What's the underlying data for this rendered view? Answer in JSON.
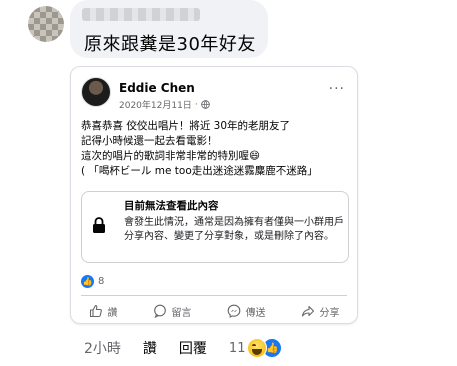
{
  "comment": {
    "text": "原來跟糞是30年好友",
    "time": "2小時",
    "like_label": "讚",
    "reply_label": "回覆",
    "reaction_count": "11"
  },
  "shared_post": {
    "author": "Eddie Chen",
    "date": "2020年12月11日",
    "more": "···",
    "lines": [
      "恭喜恭喜  佼佼出唱片！將近 30年的老朋友了",
      "記得小時候還一起去看電影！",
      "這次的唱片的歌詞非常非常的特別喔😄",
      "(    「喝杯ビール me too走出迷途迷霧麋鹿不迷路」"
    ],
    "unavailable_title": "目前無法查看此內容",
    "unavailable_desc": "會發生此情況，通常是因為擁有者僅與一小群用戶分享內容、變更了分享對象，或是刪除了內容。",
    "like_count": "8",
    "actions": {
      "like": "讚",
      "comment": "留言",
      "send": "傳送",
      "share": "分享"
    }
  },
  "colors": {
    "accent": "#1877f2",
    "muted": "#65676b",
    "bubble": "#f0f2f5"
  }
}
